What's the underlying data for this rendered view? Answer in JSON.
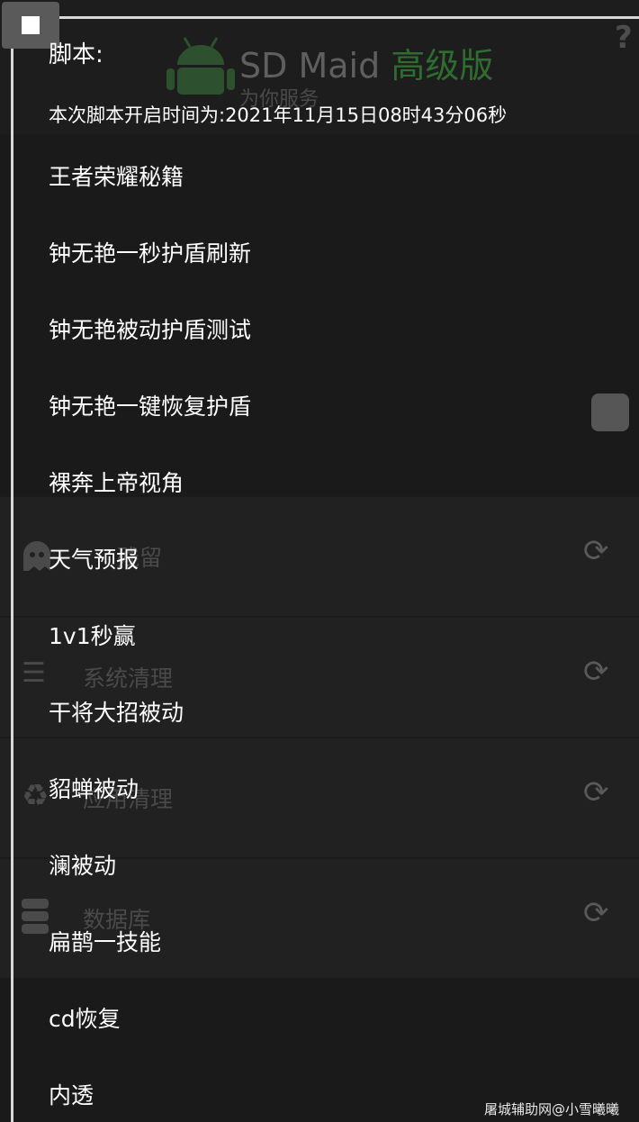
{
  "background_app": {
    "app_name": "SD Maid",
    "edition": "高级版",
    "subtitle": "为你服务",
    "help": "?",
    "rows": [
      {
        "icon": "ghost-icon",
        "label": "残留"
      },
      {
        "icon": "list-icon",
        "label": "系统清理"
      },
      {
        "icon": "recycle-icon",
        "label": "应用清理"
      },
      {
        "icon": "database-icon",
        "label": "数据库"
      }
    ],
    "refresh_glyph": "⟳"
  },
  "overlay": {
    "header": "脚本:",
    "start_time": "本次脚本开启时间为:2021年11月15日08时43分06秒",
    "items": [
      "王者荣耀秘籍",
      "钟无艳一秒护盾刷新",
      "钟无艳被动护盾测试",
      "钟无艳一键恢复护盾",
      "裸奔上帝视角",
      "天气预报",
      "1v1秒赢",
      "干将大招被动",
      "貂蝉被动",
      "澜被动",
      "扁鹊一技能",
      "cd恢复",
      "内透"
    ]
  },
  "watermark": "屠城辅助网@小雪曦曦",
  "colors": {
    "background": "#1a1a1a",
    "overlay_text": "#ffffff",
    "accent_green": "#2f6c2f"
  }
}
